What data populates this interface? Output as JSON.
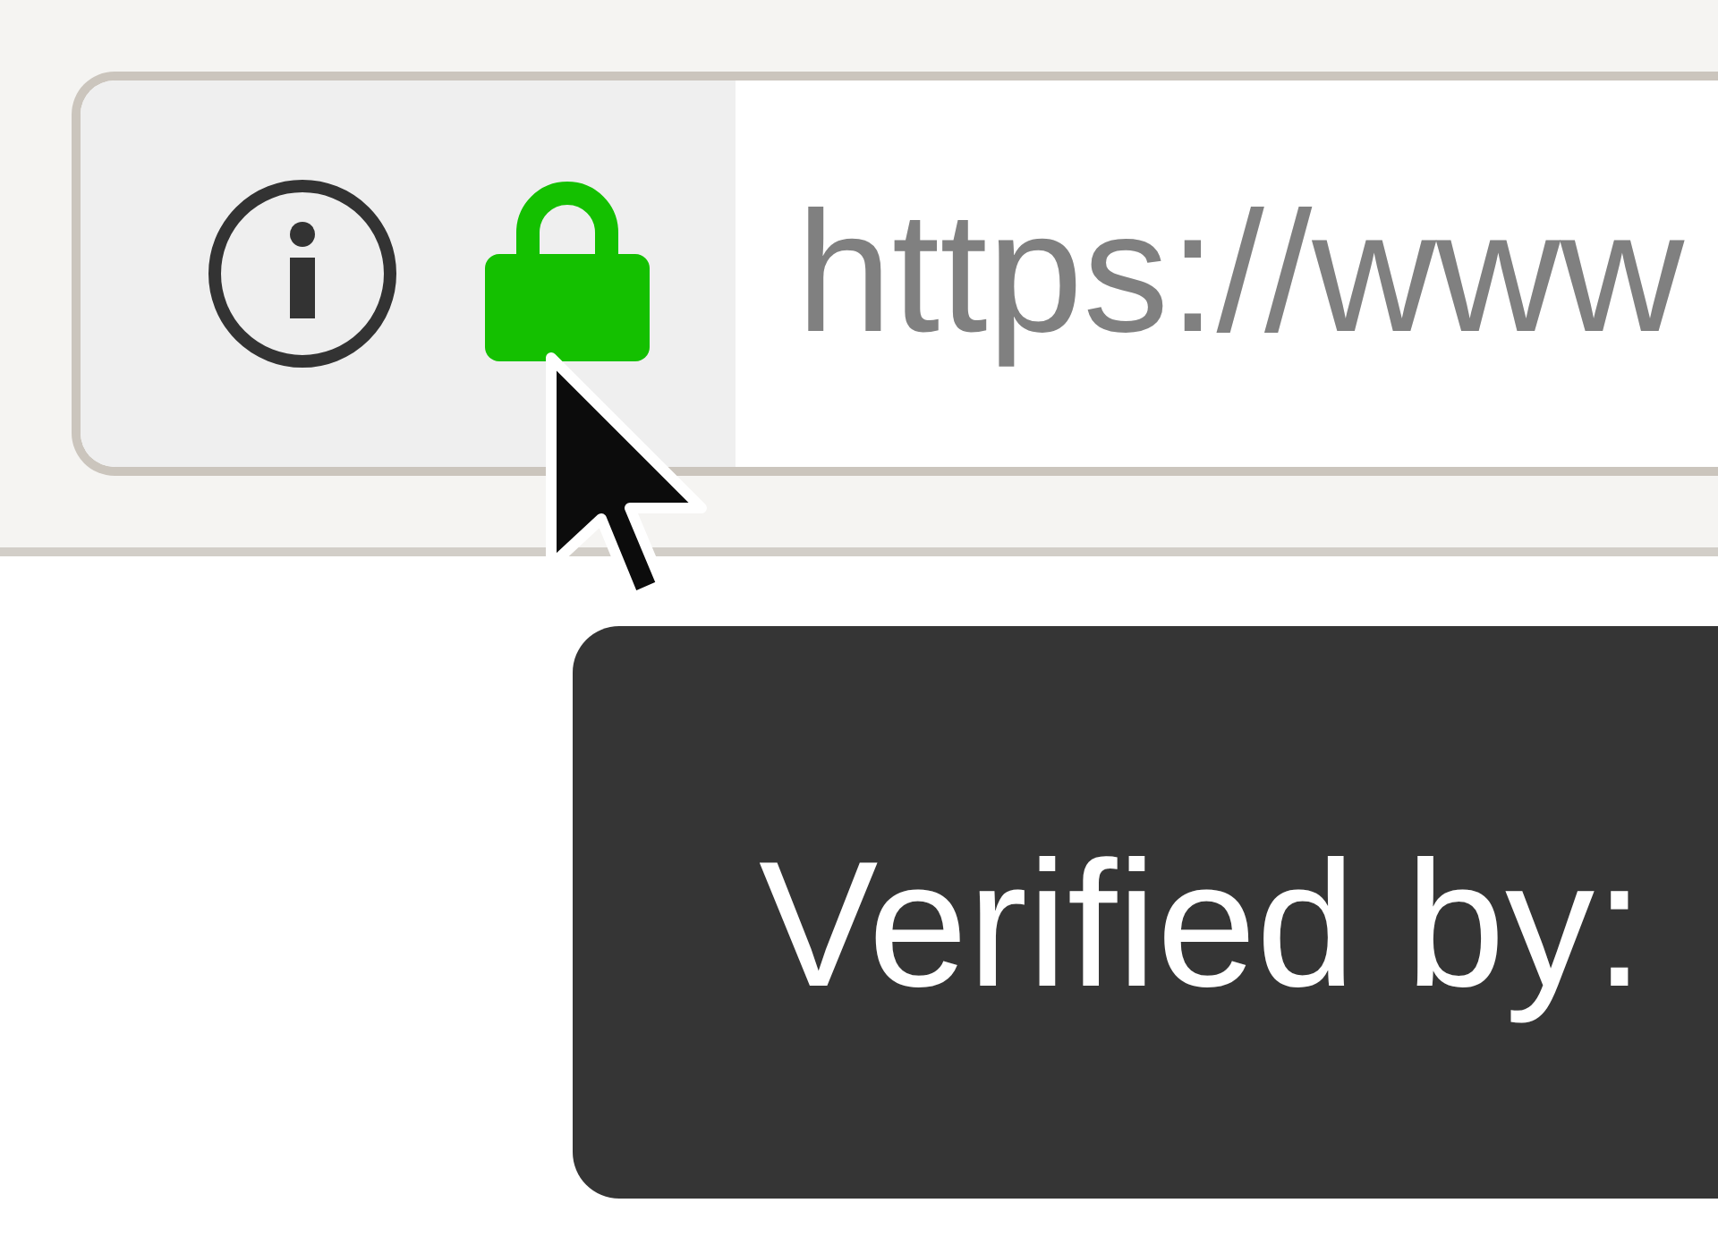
{
  "url_bar": {
    "url": "https://www"
  },
  "tooltip": {
    "text": "Verified by:"
  }
}
